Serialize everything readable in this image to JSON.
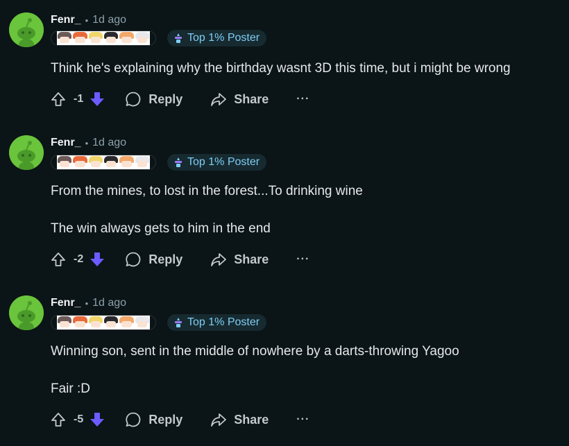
{
  "comments": [
    {
      "author": "Fenr_",
      "separator": "•",
      "time": "1d ago",
      "badge": "Top 1% Poster",
      "body": [
        "Think he's explaining why the birthday wasnt 3D this time, but i might be wrong"
      ],
      "score": "-1",
      "reply_label": "Reply",
      "share_label": "Share",
      "more_label": "···"
    },
    {
      "author": "Fenr_",
      "separator": "•",
      "time": "1d ago",
      "badge": "Top 1% Poster",
      "body": [
        "From the mines, to lost in the forest...To drinking wine",
        "The win always gets to him in the end"
      ],
      "score": "-2",
      "reply_label": "Reply",
      "share_label": "Share",
      "more_label": "···"
    },
    {
      "author": "Fenr_",
      "separator": "•",
      "time": "1d ago",
      "badge": "Top 1% Poster",
      "body": [
        "Winning son, sent in the middle of nowhere by a darts-throwing Yagoo",
        "Fair :D"
      ],
      "score": "-5",
      "reply_label": "Reply",
      "share_label": "Share",
      "more_label": "···"
    }
  ],
  "colors": {
    "background": "#0b1416",
    "downvote_active": "#6a5cff",
    "badge_text": "#7ecdf4",
    "avatar": "#6ac43c"
  },
  "icons": {
    "avatar": "snoo-avatar-icon",
    "upvote": "upvote-arrow-icon",
    "downvote": "downvote-arrow-icon",
    "reply": "comment-bubble-icon",
    "share": "share-arrow-icon",
    "badge": "top-poster-badge-icon"
  }
}
